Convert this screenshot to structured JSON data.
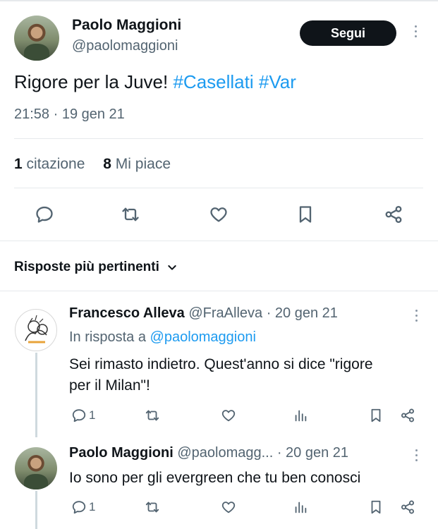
{
  "tweet": {
    "author_name": "Paolo Maggioni",
    "author_handle": "@paolomaggioni",
    "follow_label": "Segui",
    "text_plain": "Rigore per la Juve! ",
    "hashtag1": "#Casellati",
    "hashtag2": "#Var",
    "timestamp": "21:58 · 19 gen 21",
    "quotes_count": "1",
    "quotes_label": "citazione",
    "likes_count": "8",
    "likes_label": "Mi piace"
  },
  "replies_section": {
    "title": "Risposte più pertinenti"
  },
  "replies": [
    {
      "author_name": "Francesco Alleva",
      "author_handle": "@FraAlleva",
      "date": "· 20 gen 21",
      "in_reply_prefix": "In risposta a ",
      "in_reply_mention": "@paolomaggioni",
      "text_line1": "Sei rimasto indietro. Quest'anno si dice \"rigore",
      "text_line2": "per il Milan\"!",
      "reply_count": "1"
    },
    {
      "author_name": "Paolo Maggioni",
      "author_handle": "@paolomagg...",
      "date": "· 20 gen 21",
      "text_line1": "Io sono per gli evergreen che tu ben conosci",
      "reply_count": "1"
    }
  ],
  "colors": {
    "accent": "#1d9bf0",
    "text": "#0f1419",
    "muted": "#536471",
    "button": "#0f1419"
  },
  "icons": [
    "reply-icon",
    "retweet-icon",
    "like-icon",
    "bookmark-icon",
    "share-icon",
    "views-icon",
    "more-icon",
    "chevron-down-icon"
  ]
}
